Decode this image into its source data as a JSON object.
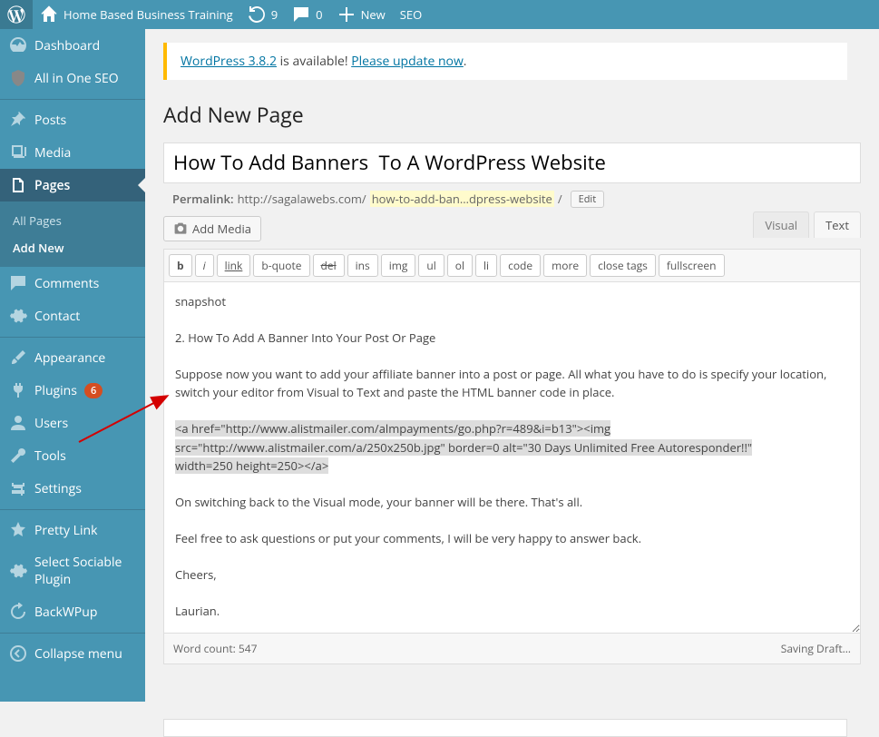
{
  "toolbar": {
    "site_title": "Home Based Business Training",
    "updates": "9",
    "comments": "0",
    "new_label": "New",
    "seo_label": "SEO"
  },
  "sidebar": {
    "dashboard": "Dashboard",
    "aioseo": "All in One SEO",
    "posts": "Posts",
    "media": "Media",
    "pages": "Pages",
    "pages_sub": {
      "all": "All Pages",
      "add_new": "Add New"
    },
    "comments": "Comments",
    "contact": "Contact",
    "appearance": "Appearance",
    "plugins": "Plugins",
    "plugin_count": "6",
    "users": "Users",
    "tools": "Tools",
    "settings": "Settings",
    "pretty_link": "Pretty Link",
    "sociable": "Select Sociable Plugin",
    "backwpup": "BackWPup",
    "collapse": "Collapse menu"
  },
  "update_nag": {
    "prefix_link": "WordPress 3.8.2",
    "mid": " is available! ",
    "action": "Please update now",
    "suffix": "."
  },
  "page_title": "Add New Page",
  "title_input": "How To Add Banners  To A WordPress Website",
  "permalink": {
    "label": "Permalink:",
    "base": "http://sagalawebs.com/",
    "slug": "how-to-add-ban…dpress-website",
    "trail": "/",
    "edit": "Edit"
  },
  "add_media": "Add Media",
  "editor_tabs": {
    "visual": "Visual",
    "text": "Text"
  },
  "quicktags": {
    "b": "b",
    "i": "i",
    "link": "link",
    "bquote": "b-quote",
    "del": "del",
    "ins": "ins",
    "img": "img",
    "ul": "ul",
    "ol": "ol",
    "li": "li",
    "code": "code",
    "more": "more",
    "close": "close tags",
    "fullscreen": "fullscreen"
  },
  "content": {
    "line1": "snapshot",
    "line2": "2. How To Add A Banner Into Your Post Or Page",
    "line3": "Suppose now you want to add your affiliate banner into a post or page. All what you have to do is specify your location, switch your editor from Visual to Text and paste the HTML banner code in place.",
    "hl1": "<a href=\"http://www.alistmailer.com/almpayments/go.php?r=489&i=b13\"><img",
    "hl2": "src=\"http://www.alistmailer.com/a/250x250b.jpg\" border=0 alt=\"30 Days Unlimited Free Autoresponder!!\"",
    "hl3": "width=250 height=250></a>",
    "line5": "On switching back to the Visual mode, your banner will be there. That's all.",
    "line6": "Feel free to ask questions or put your comments, I will be very happy to answer back.",
    "line7": "Cheers,",
    "line8": "Laurian."
  },
  "editor_status": {
    "word_count": "Word count: 547",
    "saving": "Saving Draft…"
  }
}
